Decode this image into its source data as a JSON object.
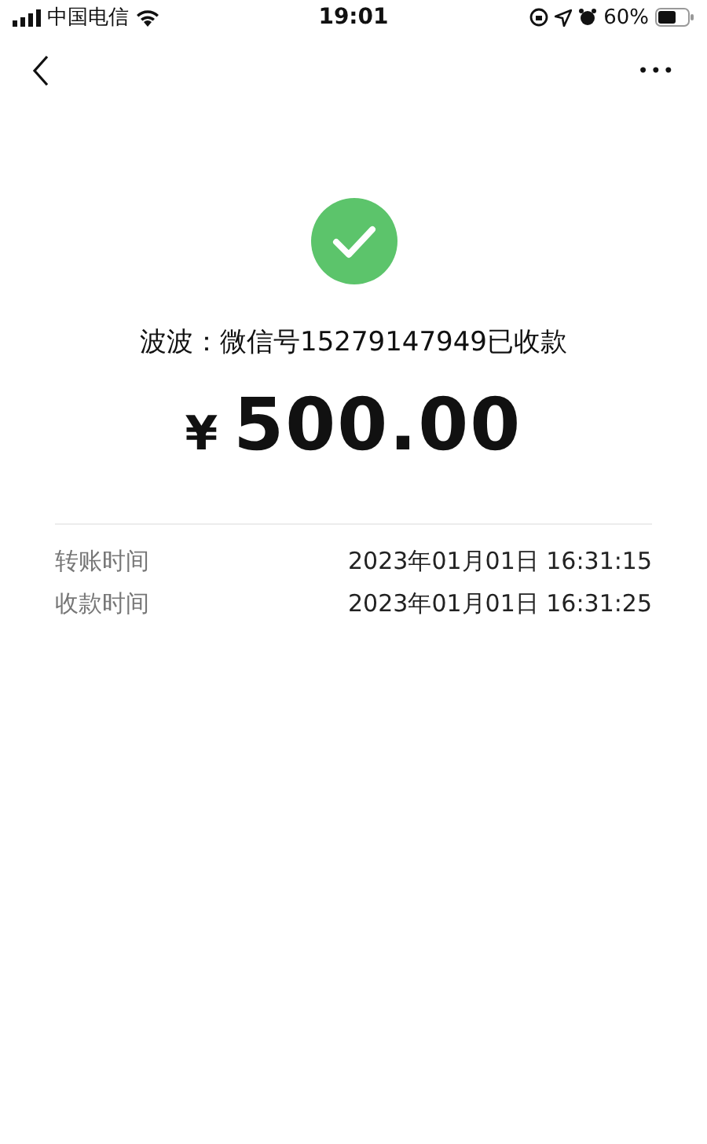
{
  "status_bar": {
    "carrier": "中国电信",
    "time": "19:01",
    "battery": "60%"
  },
  "nav": {
    "more": "•••"
  },
  "result": {
    "message": "波波：微信号15279147949已收款",
    "currency": "¥",
    "amount": "500.00"
  },
  "details": [
    {
      "label": "转账时间",
      "value": "2023年01月01日 16:31:15"
    },
    {
      "label": "收款时间",
      "value": "2023年01月01日 16:31:25"
    }
  ]
}
